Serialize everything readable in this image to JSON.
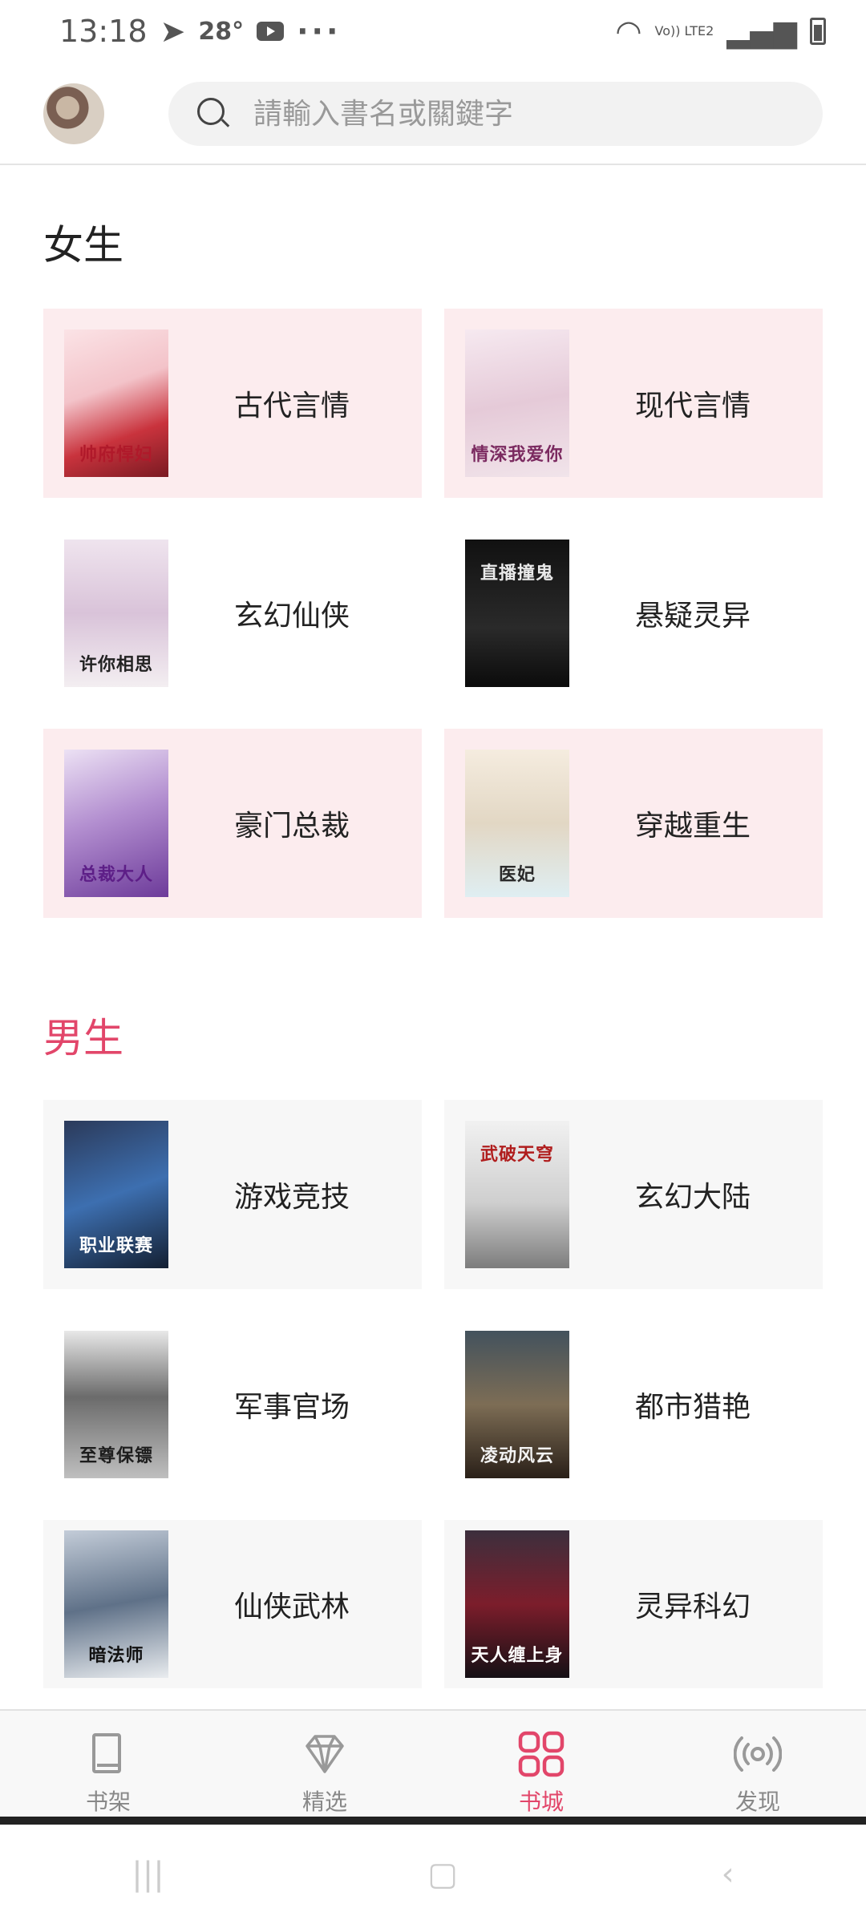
{
  "status_bar": {
    "time": "13:18",
    "temperature": "28°",
    "dots": "···",
    "network": "Vo)) LTE2"
  },
  "header": {
    "search_placeholder": "請輸入書名或關鍵字"
  },
  "women": {
    "title": "女生",
    "items": [
      {
        "label": "古代言情",
        "cover_text": "帅府悍妇",
        "tone": "pink"
      },
      {
        "label": "现代言情",
        "cover_text": "情深我爱你",
        "tone": "pink"
      },
      {
        "label": "玄幻仙侠",
        "cover_text": "许你相思",
        "tone": "white"
      },
      {
        "label": "悬疑灵异",
        "cover_text": "直播撞鬼",
        "tone": "white"
      },
      {
        "label": "豪门总裁",
        "cover_text": "总裁大人",
        "tone": "pink"
      },
      {
        "label": "穿越重生",
        "cover_text": "医妃",
        "tone": "pink"
      }
    ]
  },
  "men": {
    "title": "男生",
    "items": [
      {
        "label": "游戏竞技",
        "cover_text": "职业联赛",
        "tone": "gray"
      },
      {
        "label": "玄幻大陆",
        "cover_text": "武破天穹",
        "tone": "gray"
      },
      {
        "label": "军事官场",
        "cover_text": "至尊保镖",
        "tone": "white"
      },
      {
        "label": "都市猎艳",
        "cover_text": "凌动风云",
        "tone": "white"
      },
      {
        "label": "仙侠武林",
        "cover_text": "暗法师",
        "tone": "gray"
      },
      {
        "label": "灵异科幻",
        "cover_text": "天人缠上身",
        "tone": "gray"
      }
    ]
  },
  "bottom_nav": {
    "items": [
      {
        "label": "书架",
        "icon": "bookshelf-icon"
      },
      {
        "label": "精选",
        "icon": "diamond-icon"
      },
      {
        "label": "书城",
        "icon": "store-icon",
        "active": true
      },
      {
        "label": "发现",
        "icon": "radio-icon"
      }
    ]
  },
  "colors": {
    "accent": "#e2466a",
    "pink_card": "#fcecee",
    "gray_card": "#f7f7f7"
  }
}
